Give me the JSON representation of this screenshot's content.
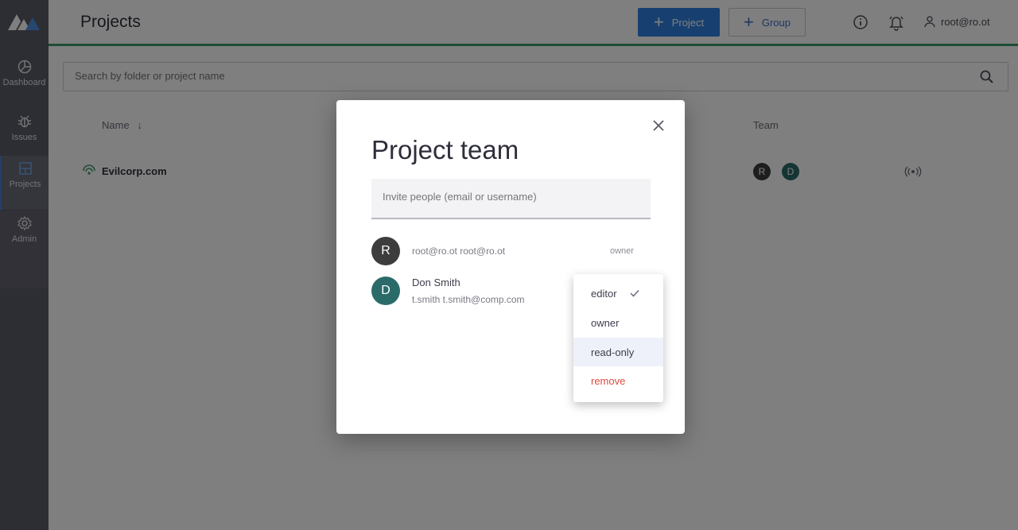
{
  "sidebar": {
    "items": [
      {
        "label": "Dashboard",
        "icon": "dashboard-icon"
      },
      {
        "label": "Issues",
        "icon": "bug-icon"
      },
      {
        "label": "Projects",
        "icon": "projects-icon"
      },
      {
        "label": "Admin",
        "icon": "gear-icon"
      }
    ],
    "active_item": "Projects"
  },
  "header": {
    "title": "Projects",
    "add_project_label": "Project",
    "add_group_label": "Group",
    "user_label": "root@ro.ot"
  },
  "search": {
    "placeholder": "Search by folder or project name"
  },
  "table": {
    "columns": [
      "Name",
      "Team"
    ],
    "rows": [
      {
        "name": "Evilcorp.com",
        "team": [
          "R",
          "D"
        ]
      }
    ]
  },
  "modal": {
    "title": "Project team",
    "invite_placeholder": "Invite people (email or username)",
    "members": [
      {
        "initial": "R",
        "line1": "root@ro.ot root@ro.ot",
        "role": "owner"
      },
      {
        "initial": "D",
        "name": "Don Smith",
        "line2": "t.smith t.smith@comp.com",
        "role": "editor"
      }
    ]
  },
  "role_menu": {
    "items": [
      "editor",
      "owner",
      "read-only",
      "remove"
    ],
    "selected": "editor",
    "hovered": "read-only"
  },
  "colors": {
    "sidebar_bg": "#5a5b68",
    "primary": "#2f80e0",
    "accent_green": "#3c9a6a",
    "avatar_dark": "#3d3d3d",
    "avatar_teal": "#2a6b6a",
    "danger": "#e04a3f"
  }
}
